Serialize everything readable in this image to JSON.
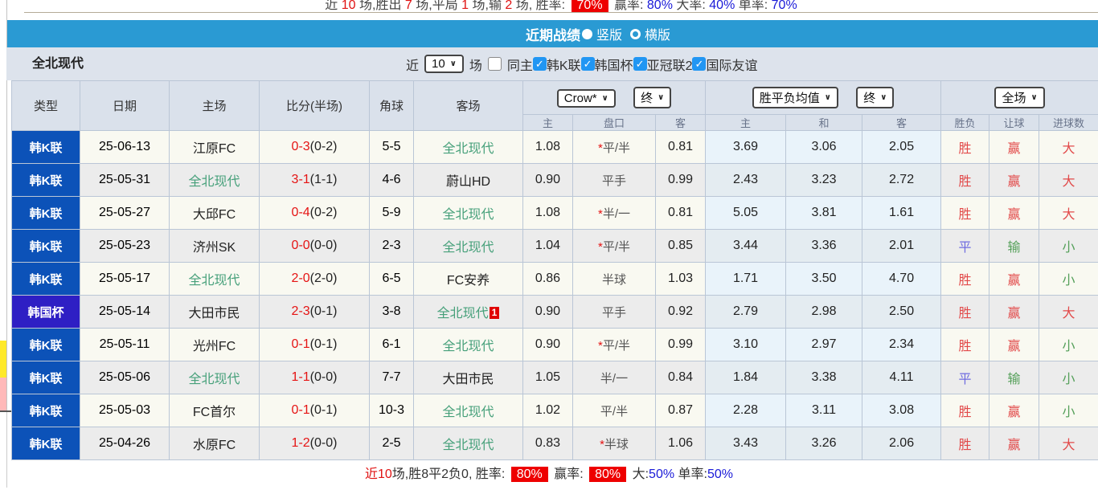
{
  "top_stats": {
    "segments": [
      {
        "t": "近 ",
        "c": "dim"
      },
      {
        "t": "10",
        "c": "red"
      },
      {
        "t": " 场,胜出 ",
        "c": "dim"
      },
      {
        "t": "7",
        "c": "red"
      },
      {
        "t": " 场,平局 ",
        "c": "dim"
      },
      {
        "t": "1",
        "c": "red"
      },
      {
        "t": " 场,输 ",
        "c": "dim"
      },
      {
        "t": "2",
        "c": "red"
      },
      {
        "t": " 场, 胜率: ",
        "c": "dim"
      },
      {
        "t": "70%",
        "c": "badge"
      },
      {
        "t": " 赢率: ",
        "c": "dim"
      },
      {
        "t": "80%",
        "c": "blue"
      },
      {
        "t": " 大率: ",
        "c": "dim"
      },
      {
        "t": "40%",
        "c": "blue"
      },
      {
        "t": " 单率: ",
        "c": "dim"
      },
      {
        "t": "70%",
        "c": "blue"
      }
    ]
  },
  "header": {
    "title": "近期战绩",
    "radio_vertical": "竖版",
    "radio_horizontal": "横版"
  },
  "filter": {
    "team": "全北现代",
    "near_label": "近",
    "count": "10",
    "unit_label": "场",
    "same_home_label": "同主",
    "leagues": [
      "韩K联",
      "韩国杯",
      "亚冠联2",
      "国际友谊"
    ]
  },
  "table": {
    "main_headers": [
      "类型",
      "日期",
      "主场",
      "比分(半场)",
      "角球",
      "客场"
    ],
    "selects": {
      "bookmaker": "Crow*",
      "bookmaker_stage": "终",
      "avg": "胜平负均值",
      "avg_stage": "终",
      "scope": "全场"
    },
    "sub_headers": [
      "主",
      "盘口",
      "客",
      "主",
      "和",
      "客",
      "胜负",
      "让球",
      "进球数"
    ],
    "rows": [
      {
        "league": "韩K联",
        "cls": "k",
        "date": "25-06-13",
        "home": "江原FC",
        "homeSelf": false,
        "ft": "0-3",
        "ht": "(0-2)",
        "corners": "5-5",
        "away": "全北现代",
        "awaySelf": true,
        "badge": "",
        "crownHome": "1.08",
        "handicap": "*平/半",
        "crownAway": "0.81",
        "avgHome": "3.69",
        "avgDraw": "3.06",
        "avgAway": "2.05",
        "result": [
          "胜",
          "red"
        ],
        "letResult": [
          "赢",
          "red"
        ],
        "goalResult": [
          "大",
          "red"
        ]
      },
      {
        "league": "韩K联",
        "cls": "k",
        "date": "25-05-31",
        "home": "全北现代",
        "homeSelf": true,
        "ft": "3-1",
        "ht": "(1-1)",
        "corners": "4-6",
        "away": "蔚山HD",
        "awaySelf": false,
        "badge": "",
        "crownHome": "0.90",
        "handicap": "平手",
        "crownAway": "0.99",
        "avgHome": "2.43",
        "avgDraw": "3.23",
        "avgAway": "2.72",
        "result": [
          "胜",
          "red"
        ],
        "letResult": [
          "赢",
          "red"
        ],
        "goalResult": [
          "大",
          "red"
        ]
      },
      {
        "league": "韩K联",
        "cls": "k",
        "date": "25-05-27",
        "home": "大邱FC",
        "homeSelf": false,
        "ft": "0-4",
        "ht": "(0-2)",
        "corners": "5-9",
        "away": "全北现代",
        "awaySelf": true,
        "badge": "",
        "crownHome": "1.08",
        "handicap": "*半/一",
        "crownAway": "0.81",
        "avgHome": "5.05",
        "avgDraw": "3.81",
        "avgAway": "1.61",
        "result": [
          "胜",
          "red"
        ],
        "letResult": [
          "赢",
          "red"
        ],
        "goalResult": [
          "大",
          "red"
        ]
      },
      {
        "league": "韩K联",
        "cls": "k",
        "date": "25-05-23",
        "home": "济州SK",
        "homeSelf": false,
        "ft": "0-0",
        "ht": "(0-0)",
        "corners": "2-3",
        "away": "全北现代",
        "awaySelf": true,
        "badge": "",
        "crownHome": "1.04",
        "handicap": "*平/半",
        "crownAway": "0.85",
        "avgHome": "3.44",
        "avgDraw": "3.36",
        "avgAway": "2.01",
        "result": [
          "平",
          "blue"
        ],
        "letResult": [
          "输",
          "green"
        ],
        "goalResult": [
          "小",
          "green"
        ]
      },
      {
        "league": "韩K联",
        "cls": "k",
        "date": "25-05-17",
        "home": "全北现代",
        "homeSelf": true,
        "ft": "2-0",
        "ht": "(2-0)",
        "corners": "6-5",
        "away": "FC安养",
        "awaySelf": false,
        "badge": "",
        "crownHome": "0.86",
        "handicap": "半球",
        "crownAway": "1.03",
        "avgHome": "1.71",
        "avgDraw": "3.50",
        "avgAway": "4.70",
        "result": [
          "胜",
          "red"
        ],
        "letResult": [
          "赢",
          "red"
        ],
        "goalResult": [
          "小",
          "green"
        ]
      },
      {
        "league": "韩国杯",
        "cls": "cup",
        "date": "25-05-14",
        "home": "大田市民",
        "homeSelf": false,
        "ft": "2-3",
        "ht": "(0-1)",
        "corners": "3-8",
        "away": "全北现代",
        "awaySelf": true,
        "badge": "1",
        "crownHome": "0.90",
        "handicap": "平手",
        "crownAway": "0.92",
        "avgHome": "2.79",
        "avgDraw": "2.98",
        "avgAway": "2.50",
        "result": [
          "胜",
          "red"
        ],
        "letResult": [
          "赢",
          "red"
        ],
        "goalResult": [
          "大",
          "red"
        ]
      },
      {
        "league": "韩K联",
        "cls": "k",
        "date": "25-05-11",
        "home": "光州FC",
        "homeSelf": false,
        "ft": "0-1",
        "ht": "(0-1)",
        "corners": "6-1",
        "away": "全北现代",
        "awaySelf": true,
        "badge": "",
        "crownHome": "0.90",
        "handicap": "*平/半",
        "crownAway": "0.99",
        "avgHome": "3.10",
        "avgDraw": "2.97",
        "avgAway": "2.34",
        "result": [
          "胜",
          "red"
        ],
        "letResult": [
          "赢",
          "red"
        ],
        "goalResult": [
          "小",
          "green"
        ]
      },
      {
        "league": "韩K联",
        "cls": "k",
        "date": "25-05-06",
        "home": "全北现代",
        "homeSelf": true,
        "ft": "1-1",
        "ht": "(0-0)",
        "corners": "7-7",
        "away": "大田市民",
        "awaySelf": false,
        "badge": "",
        "crownHome": "1.05",
        "handicap": "半/一",
        "crownAway": "0.84",
        "avgHome": "1.84",
        "avgDraw": "3.38",
        "avgAway": "4.11",
        "result": [
          "平",
          "blue"
        ],
        "letResult": [
          "输",
          "green"
        ],
        "goalResult": [
          "小",
          "green"
        ]
      },
      {
        "league": "韩K联",
        "cls": "k",
        "date": "25-05-03",
        "home": "FC首尔",
        "homeSelf": false,
        "ft": "0-1",
        "ht": "(0-1)",
        "corners": "10-3",
        "away": "全北现代",
        "awaySelf": true,
        "badge": "",
        "crownHome": "1.02",
        "handicap": "平/半",
        "crownAway": "0.87",
        "avgHome": "2.28",
        "avgDraw": "3.11",
        "avgAway": "3.08",
        "result": [
          "胜",
          "red"
        ],
        "letResult": [
          "赢",
          "red"
        ],
        "goalResult": [
          "小",
          "green"
        ]
      },
      {
        "league": "韩K联",
        "cls": "k",
        "date": "25-04-26",
        "home": "水原FC",
        "homeSelf": false,
        "ft": "1-2",
        "ht": "(0-0)",
        "corners": "2-5",
        "away": "全北现代",
        "awaySelf": true,
        "badge": "",
        "crownHome": "0.83",
        "handicap": "*半球",
        "crownAway": "1.06",
        "avgHome": "3.43",
        "avgDraw": "3.26",
        "avgAway": "2.06",
        "result": [
          "胜",
          "red"
        ],
        "letResult": [
          "赢",
          "red"
        ],
        "goalResult": [
          "大",
          "red"
        ]
      }
    ]
  },
  "summary": {
    "segments": [
      {
        "t": "近",
        "c": "red"
      },
      {
        "t": "10",
        "c": "red"
      },
      {
        "t": "场,胜8平2负0, 胜率: ",
        "c": "dark"
      },
      {
        "t": "80%",
        "c": "badge"
      },
      {
        "t": " 赢率: ",
        "c": "dark"
      },
      {
        "t": "80%",
        "c": "badge"
      },
      {
        "t": " 大:",
        "c": "dark"
      },
      {
        "t": "50%",
        "c": "blue"
      },
      {
        "t": " 单率:",
        "c": "dark"
      },
      {
        "t": "50%",
        "c": "blue"
      }
    ]
  },
  "colors": {
    "title_bar": "#2a9ad3",
    "league_k": "#0c52b8",
    "league_cup": "#2e1fc4",
    "self_team_green": "#46a07a",
    "score_red": "#e51414",
    "badge_red": "#ee0000",
    "link_blue": "#1a1ad8",
    "checkbox_blue": "#2196f3"
  }
}
